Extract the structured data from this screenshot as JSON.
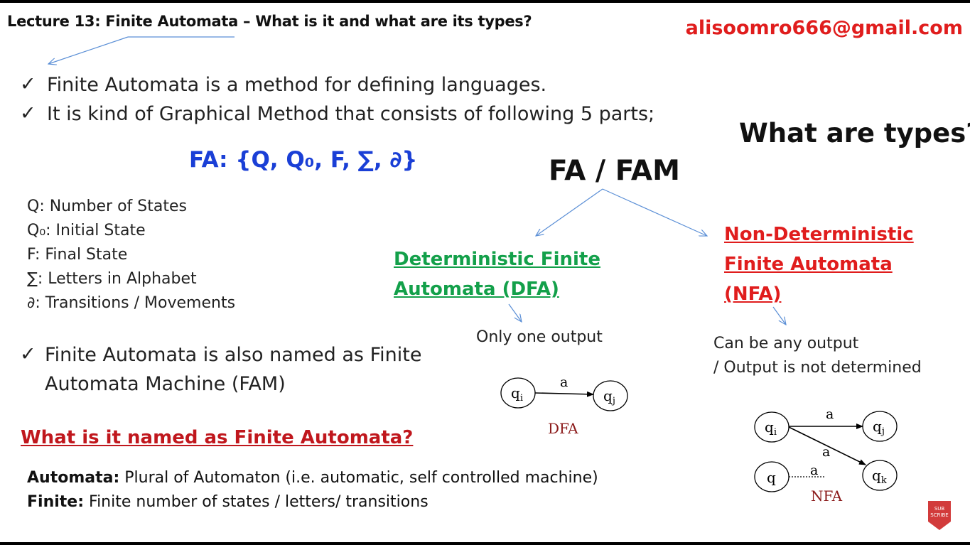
{
  "title": "Lecture 13: Finite Automata – What is it and what are its types?",
  "email": "alisoomro666@gmail.com",
  "bullets": [
    "Finite Automata is a method for defining languages.",
    "It is kind of Graphical Method that consists of following 5 parts;"
  ],
  "fa_set": "FA: {Q, Q₀, F, ∑, ∂}",
  "definitions": [
    "Q: Number of States",
    "Q₀: Initial State",
    "F: Final State",
    "∑: Letters in Alphabet",
    "∂: Transitions / Movements"
  ],
  "bullet3": {
    "line1": "Finite Automata is also named as Finite",
    "line2": "Automata Machine (FAM)"
  },
  "types_heading": "What are types?",
  "fam_label": "FA / FAM",
  "dfa": {
    "title_line1": "Deterministic Finite",
    "title_line2": "Automata (DFA)",
    "output": "Only one output",
    "diagram": {
      "state_from": "q",
      "sub_from": "i",
      "state_to": "q",
      "sub_to": "j",
      "symbol": "a",
      "caption": "DFA"
    }
  },
  "nfa": {
    "title_line1": "Non-Deterministic",
    "title_line2": "Finite Automata",
    "title_line3": "(NFA)",
    "output_line1": "Can be any output",
    "output_line2": "/ Output is not determined",
    "diagram": {
      "qi": "q",
      "qi_sub": "i",
      "qj": "q",
      "qj_sub": "j",
      "qk": "q",
      "qk_sub": "k",
      "q": "q",
      "symbol_1": "a",
      "symbol_2": "a",
      "symbol_3": "a",
      "caption": "NFA"
    }
  },
  "named_question": "What is it named as Finite Automata?",
  "descriptions": [
    {
      "term": "Automata:",
      "text": " Plural of Automaton (i.e. automatic,  self controlled machine)"
    },
    {
      "term": "Finite:",
      "text": " Finite number of states / letters/ transitions"
    }
  ],
  "subscribe_badge": {
    "line1": "SUB",
    "line2": "SCRIBE"
  },
  "colors": {
    "red": "#e01d1d",
    "green": "#13a04a",
    "blue": "#1a3fd6",
    "arrow": "#5b8fd6"
  }
}
